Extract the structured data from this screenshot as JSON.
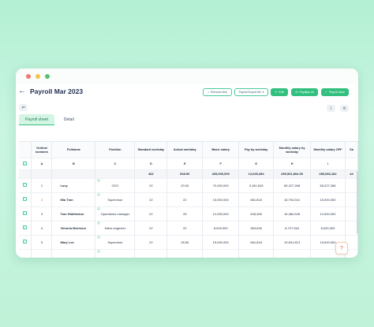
{
  "window_dots": [
    "#f07a6a",
    "#f5c34d",
    "#56c26a"
  ],
  "header": {
    "back_icon": "arrow-left-icon",
    "title": "Payroll Mar 2023",
    "buttons": {
      "remove": "Remove item",
      "export": "Payroll Export file",
      "edit": "Edit",
      "payslips": "Payslips all",
      "payroll": "Payroll done"
    }
  },
  "tabs": [
    "Payroll sheet",
    "Detail"
  ],
  "table": {
    "headers": [
      "Ordinal numbers",
      "Fullname",
      "Position",
      "Standard workday",
      "Actual workday",
      "Basic salary",
      "Pay by workday",
      "Monthly salary by workday",
      "Monthly salary OFF",
      "Sa"
    ],
    "letters": [
      "A",
      "B",
      "C",
      "D",
      "E",
      "F",
      "G",
      "H",
      "I"
    ],
    "totals": [
      "462",
      "548.50",
      "265,000,000",
      "12,045,454",
      "299,931,804.50",
      "280,083,182",
      "44"
    ],
    "rows": [
      {
        "no": "1",
        "name": "Lucy",
        "position": "CEO",
        "standard": "22",
        "actual": "20.00",
        "basic": "70,000,000",
        "pay": "3,181,818",
        "monthly": "65,227,268",
        "off": "65,227,268"
      },
      {
        "no": "2",
        "name": "Mia Tran",
        "position": "Supervisor",
        "standard": "22",
        "actual": "22",
        "basic": "15,000,000",
        "pay": "681,818",
        "monthly": "16,704,541",
        "off": "15,000,000"
      },
      {
        "no": "3",
        "name": "Tom Hiddleston",
        "position": "Operations manager",
        "standard": "22",
        "actual": "25",
        "basic": "12,000,000",
        "pay": "545,455",
        "monthly": "16,484,545",
        "off": "12,000,000"
      },
      {
        "no": "4",
        "name": "Victoria Morrizon",
        "position": "Sales engineer",
        "standard": "22",
        "actual": "22",
        "basic": "8,000,000",
        "pay": "363,636",
        "monthly": "8,727,264",
        "off": "8,000,000"
      },
      {
        "no": "5",
        "name": "Mary Lee",
        "position": "Supervisor",
        "standard": "22",
        "actual": "28.50",
        "basic": "15,000,000",
        "pay": "681,818",
        "monthly": "19,631,813",
        "off": "15,000,000"
      }
    ]
  },
  "colors": {
    "accent": "#33c07f",
    "title": "#1e2d50",
    "row2_number": "#e0483a"
  },
  "help_icon": "?"
}
